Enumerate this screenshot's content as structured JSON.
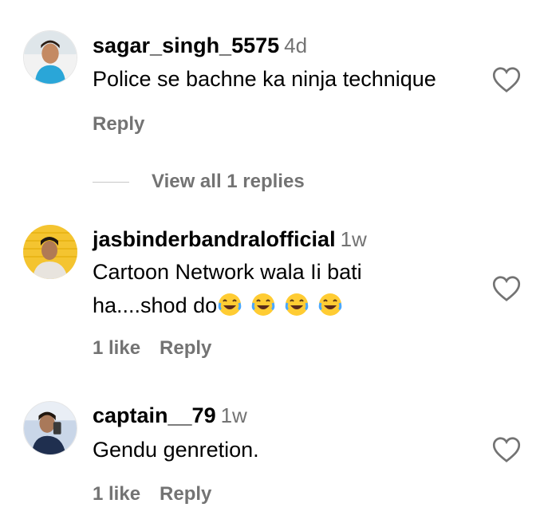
{
  "comments": [
    {
      "username": "sagar_singh_5575",
      "time": "4d",
      "text": "Police se bachne ka ninja technique",
      "likes": "",
      "reply": "Reply",
      "avatar_icon": "profile-photo",
      "view_replies": "View all 1 replies"
    },
    {
      "username": "jasbinderbandralofficial",
      "time": "1w",
      "text_line1": "Cartoon Network wala Ii bati",
      "text_line2": "ha....shod do",
      "emoji": "face-with-tears-of-joy",
      "emoji_count": 4,
      "likes": "1 like",
      "reply": "Reply"
    },
    {
      "username": "captain__79",
      "time": "1w",
      "text": "Gendu genretion.",
      "likes": "1 like",
      "reply": "Reply"
    }
  ],
  "colors": {
    "text": "#000000",
    "secondary": "#737373",
    "divider": "#c7c7c7"
  }
}
